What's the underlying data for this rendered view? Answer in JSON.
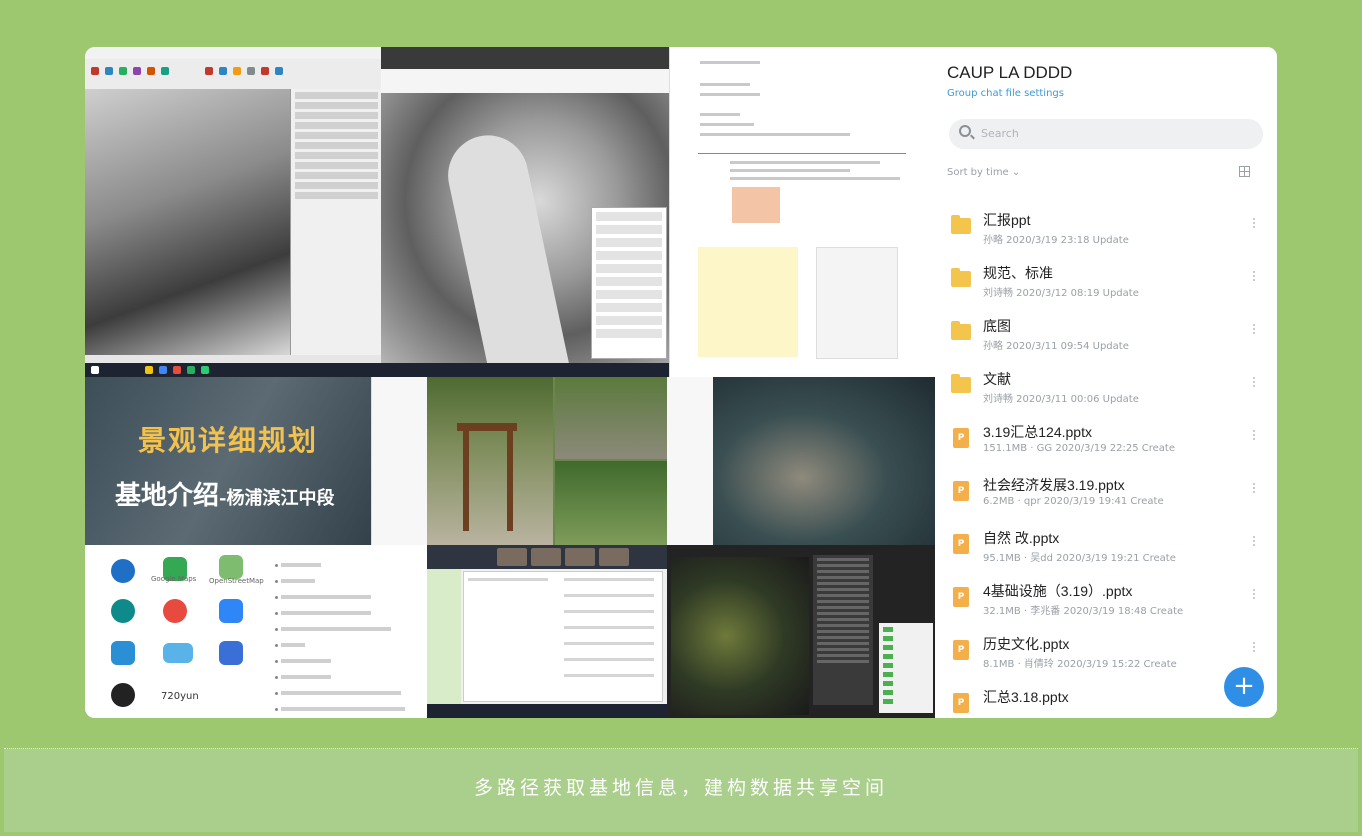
{
  "collage": {
    "slide_title": "景观详细规划",
    "slide_subtitle": "基地介绍",
    "slide_subtitle_suffix": "-杨浦滨江中段",
    "icons": [
      {
        "name": "Google Earth",
        "icon": "google-earth-icon",
        "color": "#1e6fc5",
        "label": ""
      },
      {
        "name": "Google Maps",
        "icon": "google-maps-icon",
        "color": "#34a853",
        "label": "Google Maps"
      },
      {
        "name": "OpenStreetMap",
        "icon": "openstreetmap-icon",
        "color": "#7ebc6f",
        "label": "OpenStreetMap"
      },
      {
        "name": "Bing",
        "icon": "bing-icon",
        "color": "#0f8a8a",
        "label": ""
      },
      {
        "name": "Baidu Maps",
        "icon": "baidu-maps-icon",
        "color": "#e94a3f",
        "label": ""
      },
      {
        "name": "Amap",
        "icon": "amap-icon",
        "color": "#2f86f6",
        "label": ""
      },
      {
        "name": "Tianditu",
        "icon": "tianditu-icon",
        "color": "#2a8fd4",
        "label": ""
      },
      {
        "name": "Map app",
        "icon": "map-app-icon",
        "color": "#5ab3e8",
        "label": ""
      },
      {
        "name": "Tencent Maps",
        "icon": "tencent-maps-icon",
        "color": "#3a6fd8",
        "label": ""
      },
      {
        "name": "Compass",
        "icon": "compass-icon",
        "color": "#222222",
        "label": ""
      },
      {
        "name": "720yun",
        "icon": "720yun-icon",
        "color": "#444444",
        "label": "720yun"
      }
    ]
  },
  "panel": {
    "title": "CAUP LA DDDD",
    "settings_link": "Group chat file settings",
    "search_placeholder": "Search",
    "sort_label": "Sort by time",
    "accent_color": "#2f8ee6",
    "files": [
      {
        "name": "汇报ppt",
        "meta": "孙略 2020/3/19 23:18 Update",
        "type": "folder"
      },
      {
        "name": "规范、标准",
        "meta": "刘诗畅 2020/3/12 08:19 Update",
        "type": "folder"
      },
      {
        "name": "底图",
        "meta": "孙略 2020/3/11 09:54 Update",
        "type": "folder"
      },
      {
        "name": "文献",
        "meta": "刘诗畅 2020/3/11 00:06 Update",
        "type": "folder"
      },
      {
        "name": "3.19汇总124.pptx",
        "meta": "151.1MB · GG 2020/3/19 22:25 Create",
        "type": "ppt"
      },
      {
        "name": "社会经济发展3.19.pptx",
        "meta": "6.2MB · qpr 2020/3/19 19:41 Create",
        "type": "ppt"
      },
      {
        "name": "自然 改.pptx",
        "meta": "95.1MB · 吴dd 2020/3/19 19:21 Create",
        "type": "ppt"
      },
      {
        "name": "4基础设施（3.19）.pptx",
        "meta": "32.1MB · 李兆番 2020/3/19 18:48 Create",
        "type": "ppt"
      },
      {
        "name": "历史文化.pptx",
        "meta": "8.1MB · 肖倩玲 2020/3/19 15:22 Create",
        "type": "ppt"
      },
      {
        "name": "汇总3.18.pptx",
        "meta": "",
        "type": "ppt"
      }
    ],
    "add_label": "+"
  },
  "footer": {
    "caption": "多路径获取基地信息，建构数据共享空间"
  }
}
